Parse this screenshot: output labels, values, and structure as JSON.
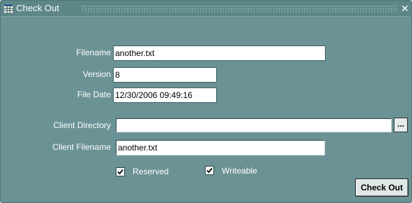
{
  "window": {
    "title": "Check Out",
    "close_glyph": "✕",
    "app_icon": "grid-app-icon"
  },
  "form": {
    "filename_label": "Filename",
    "filename_value": "another.txt",
    "version_label": "Version",
    "version_value": "8",
    "file_date_label": "File Date",
    "file_date_value": "12/30/2006 09:49:16",
    "client_directory_label": "Client Directory",
    "client_directory_value": "",
    "browse_label": "...",
    "client_filename_label": "Client Filename",
    "client_filename_value": "another.txt"
  },
  "options": {
    "reserved_label": "Reserved",
    "reserved_checked": true,
    "writeable_label": "Writeable",
    "writeable_checked": true
  },
  "actions": {
    "check_out_label": "Check Out"
  },
  "colors": {
    "window_background": "#6b9294",
    "titlebar_background": "#5d8688",
    "field_background": "#ffffff"
  }
}
